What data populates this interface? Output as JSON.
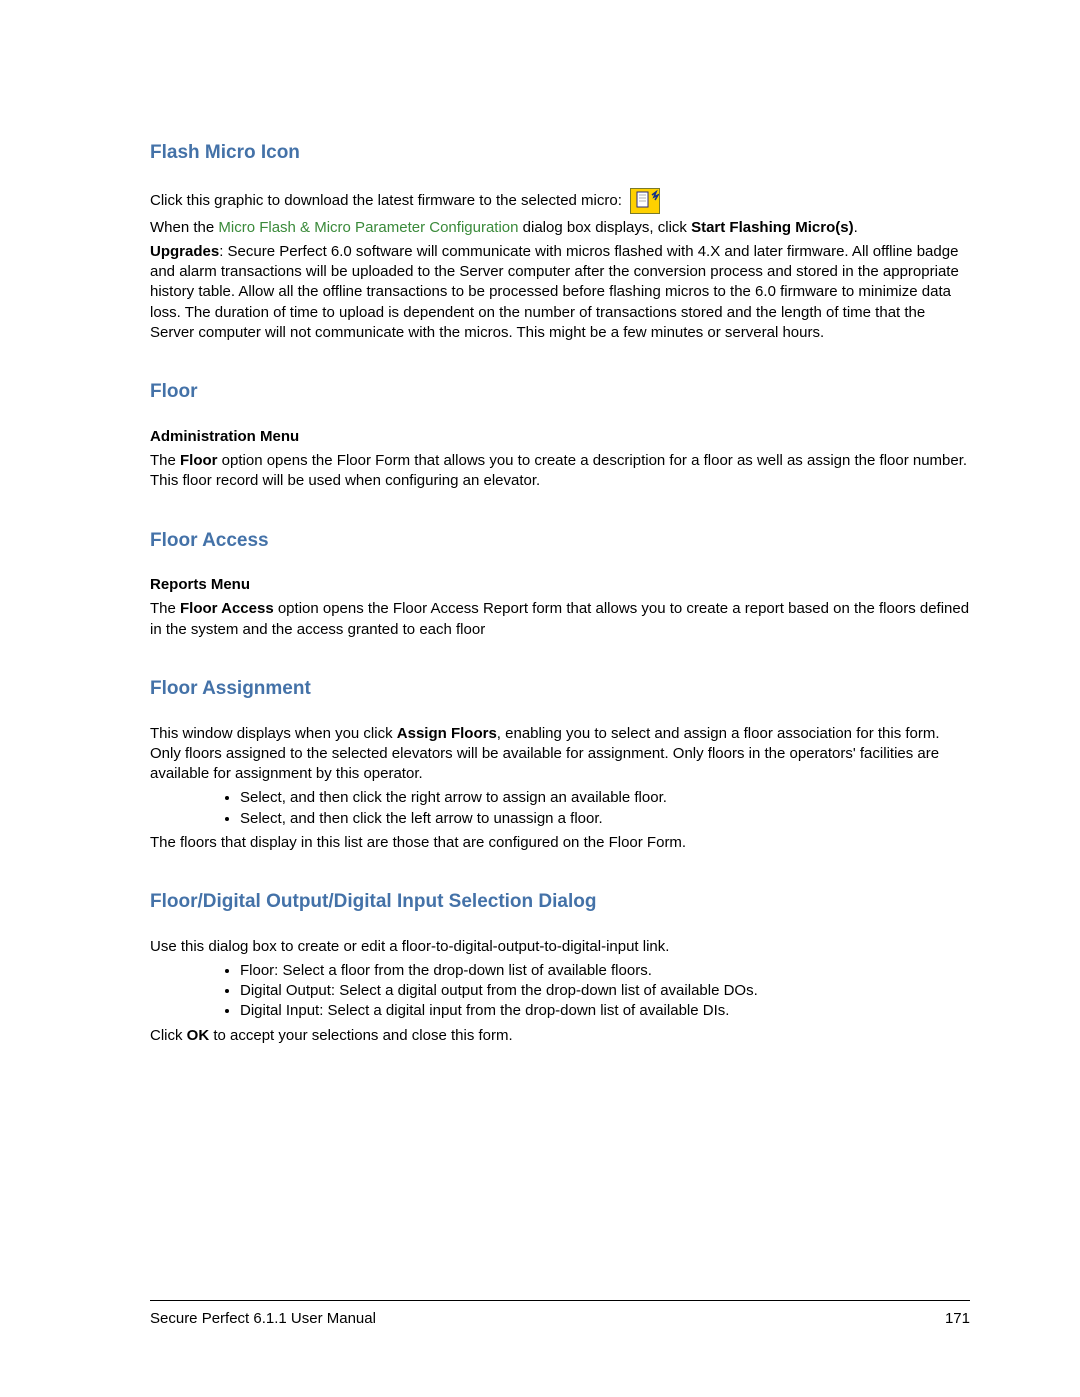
{
  "sections": {
    "flash_micro_icon": {
      "title": "Flash Micro Icon",
      "p1_lead": "Click this graphic to download the latest firmware to the selected micro: ",
      "icon_name": "flash-micro-icon",
      "p2_pre": "When the ",
      "p2_link": "Micro Flash & Micro Parameter Configuration",
      "p2_mid": " dialog box displays, click ",
      "p2_bold": "Start Flashing Micro(s)",
      "p2_post": ".",
      "p3_boldlead": "Upgrades",
      "p3_rest": ": Secure Perfect 6.0 software will communicate with micros flashed with 4.X and later firmware. All offline badge and alarm transactions will be uploaded to the Server computer after the conversion process and stored in the appropriate history table. Allow all the offline transactions to be processed before flashing micros to the 6.0 firmware to minimize data loss. The duration of time to upload is dependent on the number of transactions stored and the length of time that the Server computer will not communicate with the micros. This might be a few minutes or serveral hours."
    },
    "floor": {
      "title": "Floor",
      "sub": "Administration Menu",
      "p_pre": "The ",
      "p_bold": "Floor",
      "p_rest": " option opens the Floor Form that allows you to create a description for a floor as well as assign the floor number. This floor record will be used when configuring an elevator."
    },
    "floor_access": {
      "title": "Floor Access",
      "sub": "Reports Menu",
      "p_pre": "The ",
      "p_bold": "Floor Access",
      "p_rest": " option opens the Floor Access Report form that allows you to create a report based on the floors defined in the system and the access granted to each floor"
    },
    "floor_assignment": {
      "title": "Floor Assignment",
      "p1_pre": "This window displays when you click ",
      "p1_bold": "Assign Floors",
      "p1_rest": ", enabling you to select and assign a floor association for this form. Only floors assigned to the selected elevators will be available for assignment. Only floors in the operators' facilities are available for assignment by this operator.",
      "bullets": [
        "Select, and then click the right arrow to assign an available floor.",
        "Select, and then click the left arrow to unassign a floor."
      ],
      "p2": "The floors that display in this list are those that are configured on the Floor Form."
    },
    "selection_dialog": {
      "title": "Floor/Digital Output/Digital Input Selection Dialog",
      "p1": "Use this dialog box to create or edit a floor-to-digital-output-to-digital-input link.",
      "bullets": [
        "Floor: Select a floor from the drop-down list of available floors.",
        "Digital Output: Select a digital output from the drop-down list of available DOs.",
        "Digital Input: Select a digital input from the drop-down list of available DIs."
      ],
      "p2_pre": "Click ",
      "p2_bold": "OK",
      "p2_rest": " to accept your selections and close this form."
    }
  },
  "footer": {
    "left": "Secure Perfect 6.1.1 User Manual",
    "page": "171"
  }
}
